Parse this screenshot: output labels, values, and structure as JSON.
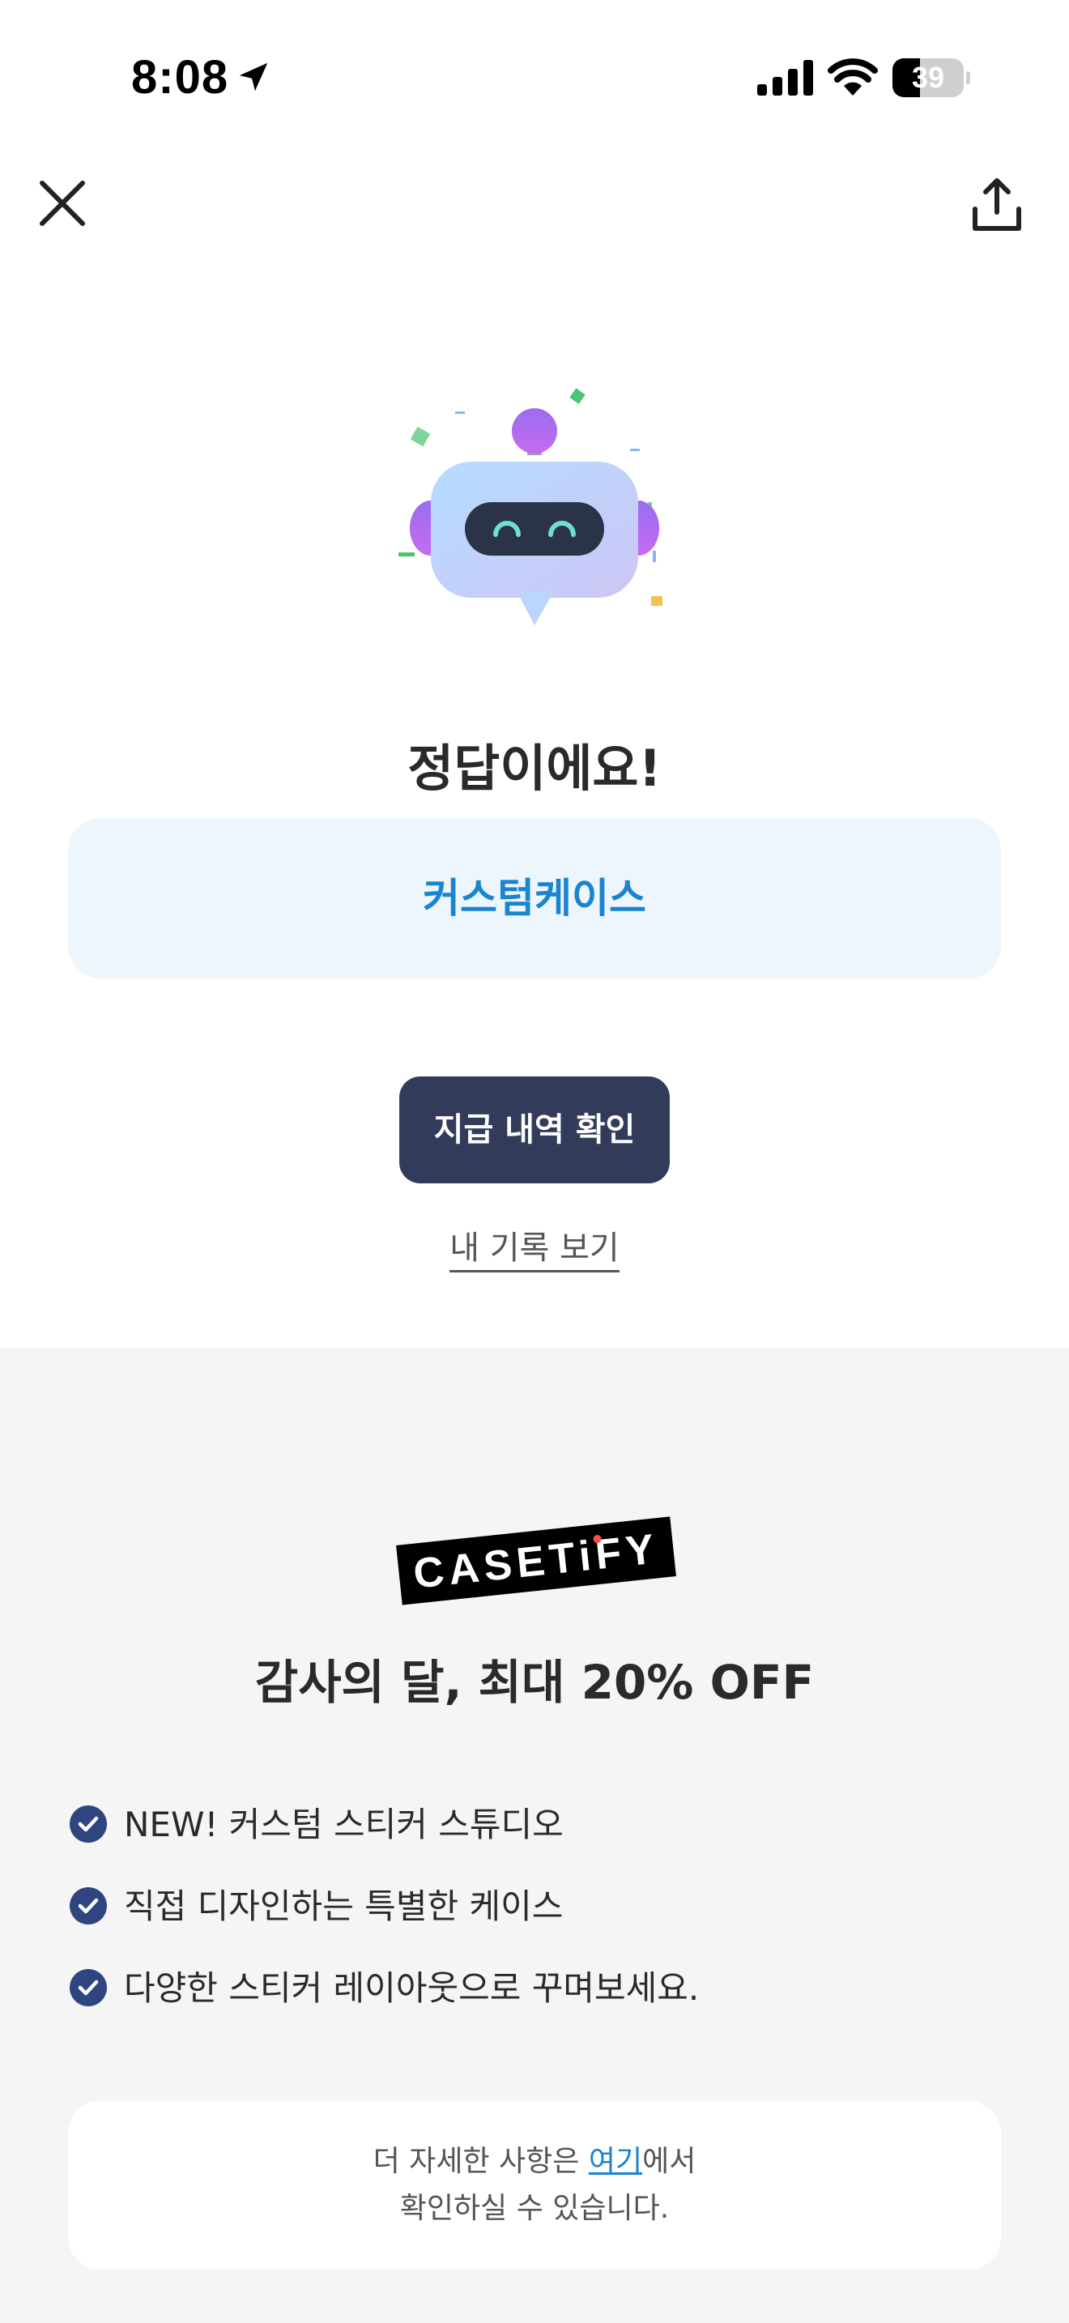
{
  "status_bar": {
    "time": "8:08",
    "battery_level": "39",
    "battery_fraction": 0.39
  },
  "nav": {
    "close_icon": "close-icon",
    "share_icon": "share-icon"
  },
  "result": {
    "title": "정답이에요!",
    "answer": "커스텀케이스"
  },
  "actions": {
    "primary_button": "지급 내역 확인",
    "record_link": "내 기록 보기"
  },
  "promo": {
    "logo_text": "CASETiFY",
    "title": "감사의 달, 최대 20% OFF",
    "features": [
      "NEW! 커스텀 스티커 스튜디오",
      "직접 디자인하는 특별한 케이스",
      "다양한 스티커 레이아웃으로 꾸며보세요."
    ],
    "info": {
      "prefix": "더 자세한 사항은 ",
      "link": "여기",
      "suffix": "에서",
      "line2": "확인하실 수 있습니다."
    }
  },
  "colors": {
    "accent_blue": "#1a84d0",
    "button_navy": "#323b5a",
    "check_navy": "#2f4580",
    "answer_bg": "#eef6fd",
    "promo_bg": "#f5f5f5"
  }
}
